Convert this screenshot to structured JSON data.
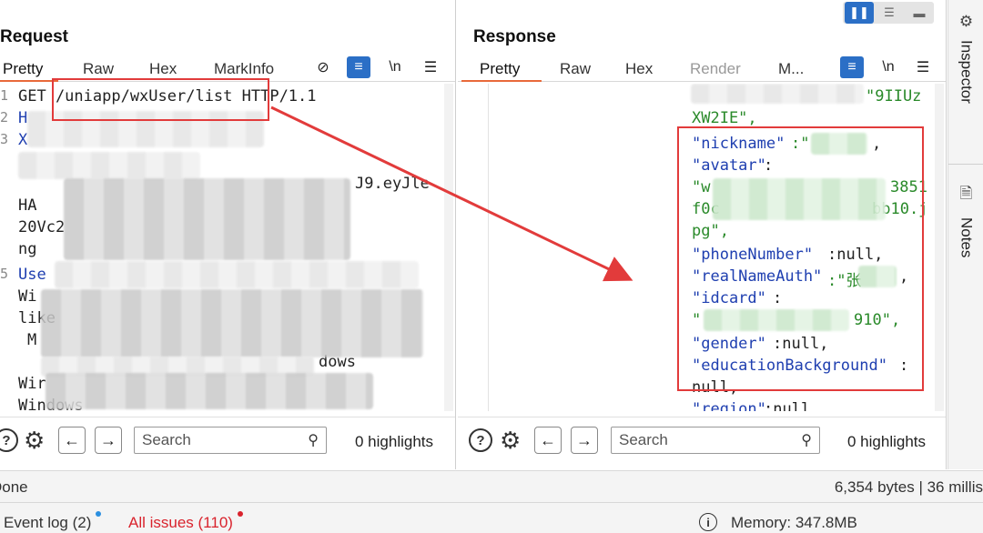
{
  "request": {
    "title": "Request",
    "tabs": [
      "Pretty",
      "Raw",
      "Hex",
      "MarkInfo"
    ],
    "tools": {
      "hide": "⊘",
      "wrap": "≡",
      "newline": "\\n",
      "menu": "☰"
    },
    "lines": [
      {
        "num": "1",
        "text": "GET /uniapp/wxUser/list HTTP/1.1"
      },
      {
        "num": "2",
        "text": "H"
      },
      {
        "num": "3",
        "text": "X"
      },
      {
        "num": "",
        "text": "J9.eyJle"
      },
      {
        "num": "",
        "text": "HA"
      },
      {
        "num": "",
        "text": "20Vc2"
      },
      {
        "num": "",
        "text": "ng"
      },
      {
        "num": "5",
        "text": "Use"
      },
      {
        "num": "",
        "text": "Wi"
      },
      {
        "num": "",
        "text": "like"
      },
      {
        "num": "",
        "text": "M"
      },
      {
        "num": "",
        "text": "dows"
      },
      {
        "num": "",
        "text": "Wir"
      },
      {
        "num": "",
        "text": "Windows"
      }
    ],
    "search_placeholder": "Search",
    "highlights": "0 highlights"
  },
  "response": {
    "title": "Response",
    "tabs": [
      "Pretty",
      "Raw",
      "Hex",
      "Render",
      "M..."
    ],
    "tools": {
      "wrap": "≡",
      "newline": "\\n",
      "menu": "☰"
    },
    "lines": [
      {
        "key": "",
        "text": "\"9IIUz"
      },
      {
        "key": "",
        "text": "XW2IE\","
      },
      {
        "key": "\"nickname\"",
        "text": ":\"",
        "tail": ","
      },
      {
        "key": "\"avatar\"",
        "text": ":"
      },
      {
        "key": "",
        "text": "\"w",
        "tail": "3851"
      },
      {
        "key": "",
        "text": "f0c",
        "tail": "bb10.j"
      },
      {
        "key": "",
        "text": "pg\","
      },
      {
        "key": "\"phoneNumber\"",
        "text": ":null,"
      },
      {
        "key": "\"realNameAuth\"",
        "text": ":\"张",
        "tail": ","
      },
      {
        "key": "\"idcard\"",
        "text": ":"
      },
      {
        "key": "",
        "text": "\"",
        "tail": "910\","
      },
      {
        "key": "\"gender\"",
        "text": ":null,"
      },
      {
        "key": "\"educationBackground\"",
        "text": ":"
      },
      {
        "key": "",
        "text": "null,"
      },
      {
        "key": "\"region\"",
        "text": ":null"
      }
    ],
    "search_placeholder": "Search",
    "highlights": "0 highlights"
  },
  "view_toggle": [
    "❚❚",
    "☰",
    "▬"
  ],
  "side_panel": [
    {
      "icon": "⚙",
      "label": "Inspector"
    },
    {
      "icon": "🗎",
      "label": "Notes"
    }
  ],
  "status": {
    "left": "Done",
    "right": "6,354 bytes | 36 millis"
  },
  "bottom": {
    "event_log": "Event log (2)",
    "issues": "All issues (110)",
    "memory": "Memory: 347.8MB"
  },
  "colors": {
    "accent": "#2b6fc6",
    "tab_underline": "#e8693a",
    "annotation": "#e23b3b",
    "issues": "#d9232d"
  }
}
